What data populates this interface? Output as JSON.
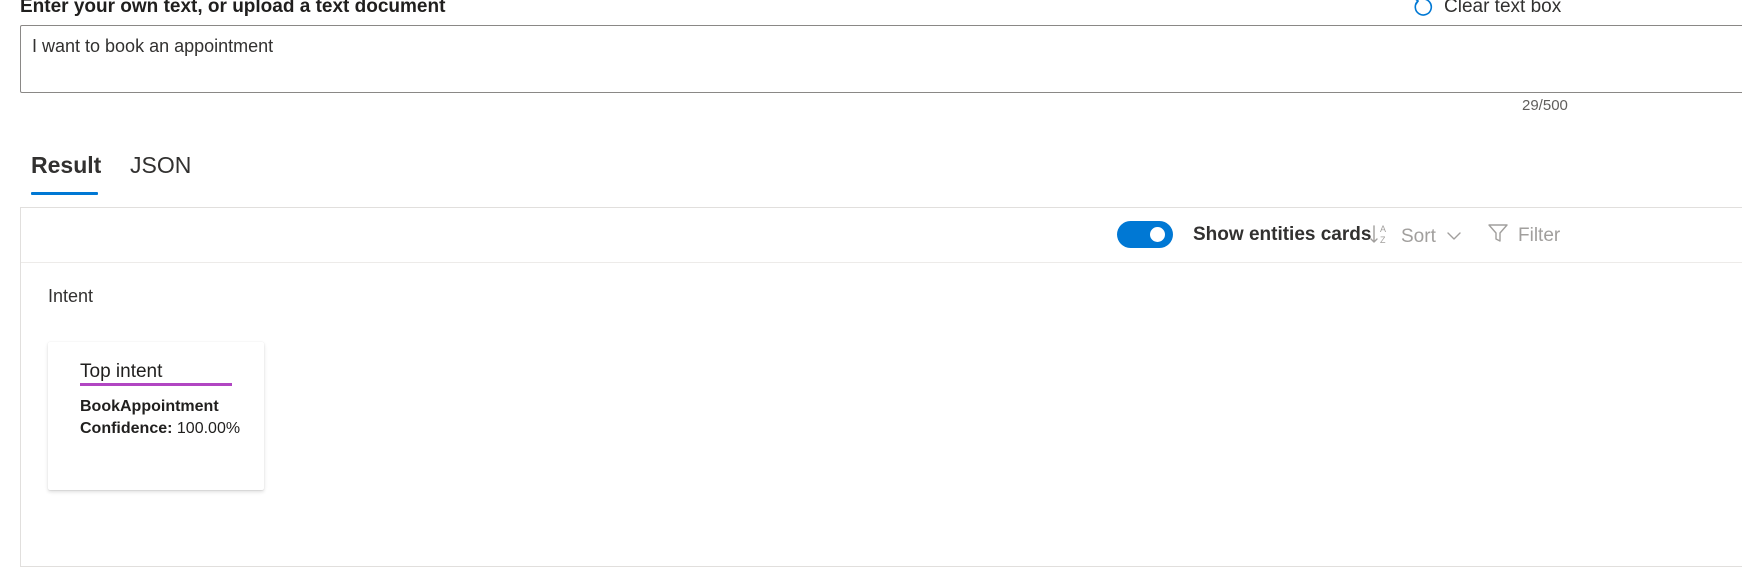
{
  "input": {
    "label": "Enter your own text, or upload a text document",
    "clear_label": "Clear text box",
    "value": "I want to book an appointment",
    "char_count": "29/500"
  },
  "tabs": [
    {
      "label": "Result",
      "selected": true
    },
    {
      "label": "JSON",
      "selected": false
    }
  ],
  "toolbar": {
    "toggle_label": "Show entities cards",
    "toggle_on": true,
    "sort_label": "Sort",
    "filter_label": "Filter"
  },
  "section": {
    "title": "Intent"
  },
  "intent_card": {
    "title": "Top intent",
    "intent_name": "BookAppointment",
    "confidence_label": "Confidence:",
    "confidence_value": "100.00%"
  },
  "colors": {
    "accent": "#0078d4",
    "card_underline": "#b146c2"
  },
  "icons": {
    "clear": "refresh-icon",
    "sort": "sort-az-icon",
    "dropdown": "chevron-down-icon",
    "filter": "filter-icon"
  }
}
